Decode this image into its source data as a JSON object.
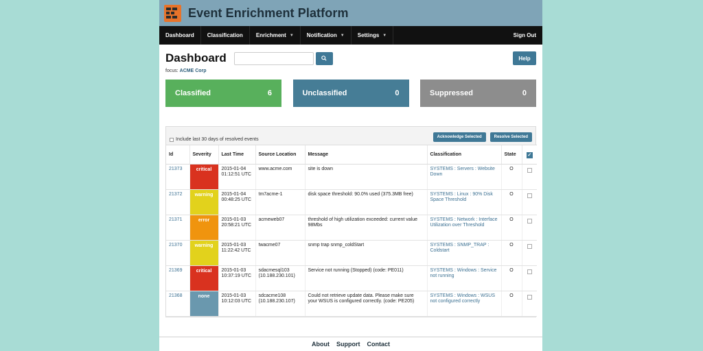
{
  "app": {
    "title": "Event Enrichment Platform"
  },
  "nav": {
    "items": [
      {
        "label": "Dashboard",
        "dropdown": false
      },
      {
        "label": "Classification",
        "dropdown": false
      },
      {
        "label": "Enrichment",
        "dropdown": true
      },
      {
        "label": "Notification",
        "dropdown": true
      },
      {
        "label": "Settings",
        "dropdown": true
      }
    ],
    "signout": "Sign Out"
  },
  "page": {
    "title": "Dashboard",
    "search": {
      "value": "",
      "placeholder": ""
    },
    "help_label": "Help",
    "focus_label": "focus:",
    "focus_value": "ACME Corp"
  },
  "tiles": [
    {
      "label": "Classified",
      "count": "6",
      "color": "#58b05c"
    },
    {
      "label": "Unclassified",
      "count": "0",
      "color": "#467d96"
    },
    {
      "label": "Suppressed",
      "count": "0",
      "color": "#8d8d8d"
    }
  ],
  "events": {
    "include_resolved_label": "Include last 30 days of resolved events",
    "acknowledge_label": "Acknowledge Selected",
    "resolve_label": "Resolve Selected",
    "columns": [
      "Id",
      "Severity",
      "Last Time",
      "Source Location",
      "Message",
      "Classification",
      "State"
    ],
    "rows": [
      {
        "id": "21373",
        "severity": "critical",
        "time": "2015-01-04 01:12:51 UTC",
        "source": "www.acme.com",
        "message": "site is down",
        "classification": "SYSTEMS : Servers : Website Down",
        "state": "O"
      },
      {
        "id": "21372",
        "severity": "warning",
        "time": "2015-01-04 00:48:25 UTC",
        "source": "tm7acme-1",
        "message": "disk space threshold: 90.0% used (375.3MB free)",
        "classification": "SYSTEMS : Linux : 90% Disk Space Threshold",
        "state": "O"
      },
      {
        "id": "21371",
        "severity": "error",
        "time": "2015-01-03 20:58:21 UTC",
        "source": "acmeweb07",
        "message": "threshold of high utilization exceeded: current value 98Mbs",
        "classification": "SYSTEMS : Network : Interface Utilization over Threshold",
        "state": "O"
      },
      {
        "id": "21370",
        "severity": "warning",
        "time": "2015-01-03 11:22:42 UTC",
        "source": "twacme07",
        "message": "snmp trap snmp_coldStart",
        "classification": "SYSTEMS : SNMP_TRAP : Coldstart",
        "state": "O"
      },
      {
        "id": "21369",
        "severity": "critical",
        "time": "2015-01-03 10:37:19 UTC",
        "source": "sdacmesql103 (10.188.230.101)",
        "message": "Service not running (Stopped) (code: PE011)",
        "classification": "SYSTEMS : Windows : Service not running",
        "state": "O"
      },
      {
        "id": "21368",
        "severity": "none",
        "time": "2015-01-03 10:12:03 UTC",
        "source": "sdcacme108 (10.188.230.107)",
        "message": "Could not retrieve update data. Please make sure your WSUS is configured correctly. (code: PE205)",
        "classification": "SYSTEMS : Windows : WSUS not configured correctly",
        "state": "O"
      }
    ]
  },
  "footer": {
    "links": [
      "About",
      "Support",
      "Contact"
    ]
  },
  "colors": {
    "accent": "#3f7896",
    "titlebar": "#7fa4b7",
    "critical": "#d9321f",
    "warning": "#e2d21c",
    "error": "#f0940e",
    "none": "#6a98ae"
  },
  "icons": {
    "logo": "ee-logo-icon",
    "search": "search-icon",
    "caret": "caret-down-icon",
    "select_all": "checkbox-checked-icon"
  }
}
